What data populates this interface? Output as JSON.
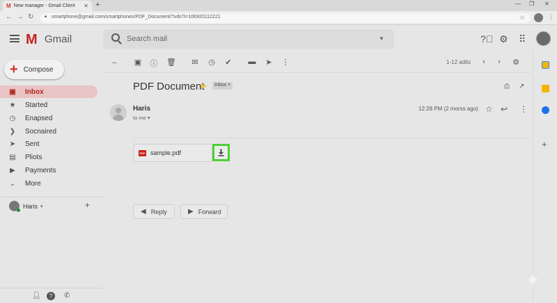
{
  "browser": {
    "tab_title": "New manager - Gmail Client",
    "url": "smartphone@gmail.com/smartphones/PDF_Document/?vds?i=106920112221",
    "tab_favicon": "M"
  },
  "header": {
    "logo_text": "Gmail",
    "logo_letter": "M",
    "search_placeholder": "Search mail"
  },
  "sidebar": {
    "compose_label": "Compose",
    "items": [
      {
        "label": "Inbox",
        "icon": "inbox-icon",
        "active": true
      },
      {
        "label": "Started",
        "icon": "star-icon"
      },
      {
        "label": "Enapsed",
        "icon": "snooze-icon"
      },
      {
        "label": "Socnaired",
        "icon": "label-icon"
      },
      {
        "label": "Sent",
        "icon": "send-icon"
      },
      {
        "label": "Pliots",
        "icon": "doc-icon"
      },
      {
        "label": "Payments",
        "icon": "tag-icon"
      },
      {
        "label": "More",
        "icon": "chevron-down-icon"
      }
    ],
    "hangouts_user": "Haris"
  },
  "toolbar": {
    "pager_text": "1-12 adits"
  },
  "message": {
    "subject": "PDF Document",
    "label": "Inbox",
    "sender": "Haris",
    "to_me": "to me",
    "date": "12:28 PM (2 morss ago)",
    "attachment_name": "sample.pdf",
    "attachment_type": "PDF",
    "reply_label": "Reply",
    "forward_label": "Forward"
  },
  "colors": {
    "accent_red": "#c5221f",
    "highlight_green": "#4cd137",
    "active_nav_bg": "#e8c4c4"
  }
}
